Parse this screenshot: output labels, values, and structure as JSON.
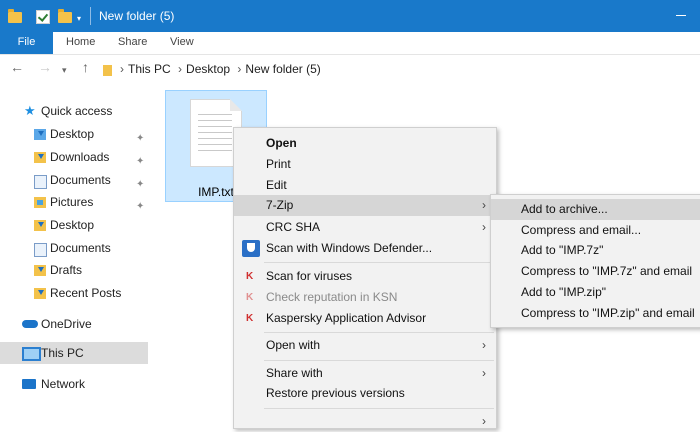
{
  "window": {
    "title": "New folder (5)"
  },
  "ribbon": {
    "tabs": [
      "File",
      "Home",
      "Share",
      "View"
    ]
  },
  "address": {
    "crumbs": [
      "This PC",
      "Desktop",
      "New folder (5)"
    ]
  },
  "nav_pane": {
    "quick_access": "Quick access",
    "items": [
      "Desktop",
      "Downloads",
      "Documents",
      "Pictures",
      "Desktop",
      "Documents",
      "Drafts",
      "Recent Posts"
    ],
    "onedrive": "OneDrive",
    "this_pc": "This PC",
    "network": "Network"
  },
  "file": {
    "name": "IMP.txt"
  },
  "context_menu": {
    "items": [
      "Open",
      "Print",
      "Edit",
      "7-Zip",
      "CRC SHA",
      "Scan with Windows Defender...",
      "Scan for viruses",
      "Check reputation in KSN",
      "Kaspersky Application Advisor",
      "Open with",
      "Share with",
      "Restore previous versions"
    ]
  },
  "submenu_7zip": {
    "items": [
      "Add to archive...",
      "Compress and email...",
      "Add to \"IMP.7z\"",
      "Compress to \"IMP.7z\" and email",
      "Add to \"IMP.zip\"",
      "Compress to \"IMP.zip\" and email"
    ]
  },
  "glyphs": {
    "arrow": "›",
    "pin": "✦",
    "k": "K"
  }
}
